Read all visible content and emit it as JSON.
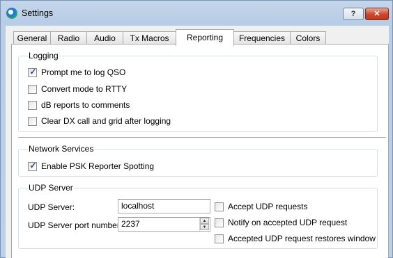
{
  "window": {
    "title": "Settings",
    "help_label": "?",
    "close_label": "✕"
  },
  "tabs": [
    {
      "label": "General",
      "active": false
    },
    {
      "label": "Radio",
      "active": false
    },
    {
      "label": "Audio",
      "active": false
    },
    {
      "label": "Tx Macros",
      "active": false
    },
    {
      "label": "Reporting",
      "active": true
    },
    {
      "label": "Frequencies",
      "active": false
    },
    {
      "label": "Colors",
      "active": false
    }
  ],
  "logging": {
    "title": "Logging",
    "items": [
      {
        "label": "Prompt me to log QSO",
        "checked": true
      },
      {
        "label": "Convert mode to RTTY",
        "checked": false
      },
      {
        "label": "dB reports to comments",
        "checked": false
      },
      {
        "label": "Clear DX call and grid after logging",
        "checked": false
      }
    ]
  },
  "network": {
    "title": "Network Services",
    "items": [
      {
        "label": "Enable PSK Reporter Spotting",
        "checked": true
      }
    ]
  },
  "udp": {
    "title": "UDP Server",
    "server_label": "UDP Server:",
    "server_value": "localhost",
    "port_label": "UDP Server port number:",
    "port_value": "2237",
    "spin_up": "▲",
    "spin_down": "▼",
    "items": [
      {
        "label": "Accept UDP requests",
        "checked": false
      },
      {
        "label": "Notify on accepted UDP request",
        "checked": false
      },
      {
        "label": "Accepted UDP request restores window",
        "checked": false
      }
    ]
  }
}
